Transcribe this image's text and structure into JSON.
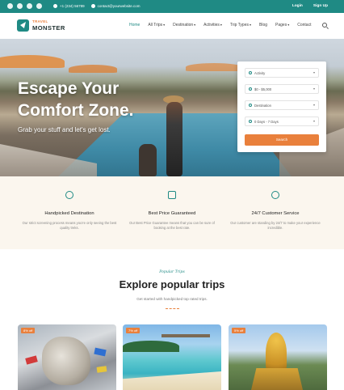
{
  "topbar": {
    "social_icons": [
      "facebook-icon",
      "twitter-icon",
      "instagram-icon",
      "youtube-icon"
    ],
    "phone": "+1 (234) 56789",
    "email": "contact@yourwebsite.com",
    "login": "Login",
    "signup": "Sign Up",
    "background": "#1f8a84"
  },
  "header": {
    "logo_top": "TRAVEL",
    "logo_bottom": "MONSTER",
    "nav": [
      {
        "label": "Home",
        "active": true,
        "dropdown": false
      },
      {
        "label": "All Trips",
        "active": false,
        "dropdown": true
      },
      {
        "label": "Destination",
        "active": false,
        "dropdown": true
      },
      {
        "label": "Activities",
        "active": false,
        "dropdown": true
      },
      {
        "label": "Trip Types",
        "active": false,
        "dropdown": true
      },
      {
        "label": "Blog",
        "active": false,
        "dropdown": false
      },
      {
        "label": "Pages",
        "active": false,
        "dropdown": true
      },
      {
        "label": "Contact",
        "active": false,
        "dropdown": false
      }
    ]
  },
  "hero": {
    "title_line1": "Escape Your",
    "title_line2": "Comfort Zone.",
    "subtitle": "Grab your stuff and let's get lost."
  },
  "search_form": {
    "fields": [
      "Activity",
      "$0 - $5,000",
      "Destination",
      "0 Days - 7 Days"
    ],
    "button": "Search",
    "button_color": "#e9803c"
  },
  "features": [
    {
      "icon": "map-pin-icon",
      "title": "Handpicked Destination",
      "desc": "Our strict screening process means you're only seeing the best quality treks."
    },
    {
      "icon": "price-tag-icon",
      "title": "Best Price Guaranteed",
      "desc": "Our Best Price Guarantee means that you can be sure of booking at the best rate."
    },
    {
      "icon": "headset-icon",
      "title": "24/7 Customer Service",
      "desc": "Our customer are standing by 24/7 to make your experience incredible."
    }
  ],
  "popular": {
    "eyebrow": "Popular Trips",
    "title": "Explore popular trips",
    "description": "Get started with handpicked top rated trips.",
    "cards": [
      {
        "badge": "8% off"
      },
      {
        "badge": "7% off"
      },
      {
        "badge": "5% off"
      }
    ]
  }
}
